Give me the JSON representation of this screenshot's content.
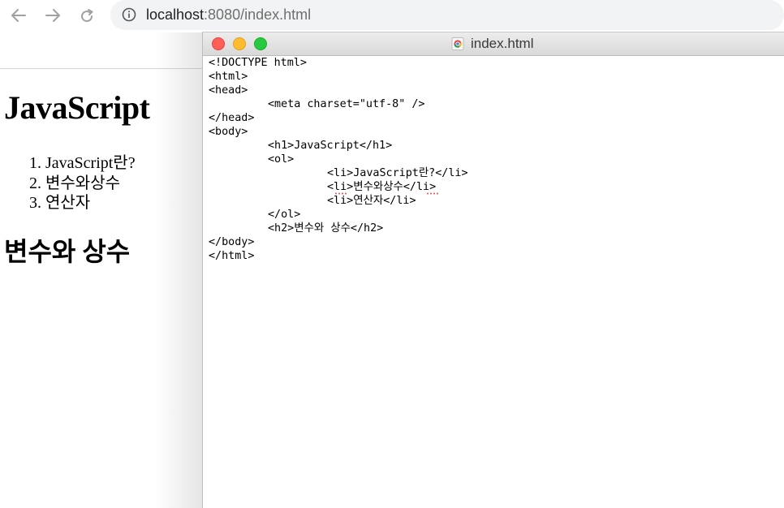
{
  "browser": {
    "url_host": "localhost",
    "url_rest": ":8080/index.html",
    "nav_icons": [
      "back-arrow-icon",
      "forward-arrow-icon",
      "reload-icon",
      "info-icon"
    ]
  },
  "rendered_page": {
    "h1": "JavaScript",
    "list_items": [
      "1. JavaScript란?",
      "2. 변수와상수",
      "3. 연산자"
    ],
    "h2": "변수와 상수"
  },
  "editor": {
    "title": "index.html",
    "traffic_lights": {
      "close": "#ff5f57",
      "minimize": "#febc2e",
      "maximize": "#28c840"
    },
    "code_lines": [
      "<!DOCTYPE html>",
      "<html>",
      "<head>",
      "<meta charset=\"utf-8\" />",
      "</head>",
      "<body>",
      "<h1>JavaScript</h1>",
      "<ol>",
      "<li>JavaScript란?</li>",
      "<li>변수와상수</li>",
      "<li>연산자</li>",
      "</ol>",
      "<h2>변수와 상수</h2>",
      "</body>",
      "</html>"
    ]
  }
}
